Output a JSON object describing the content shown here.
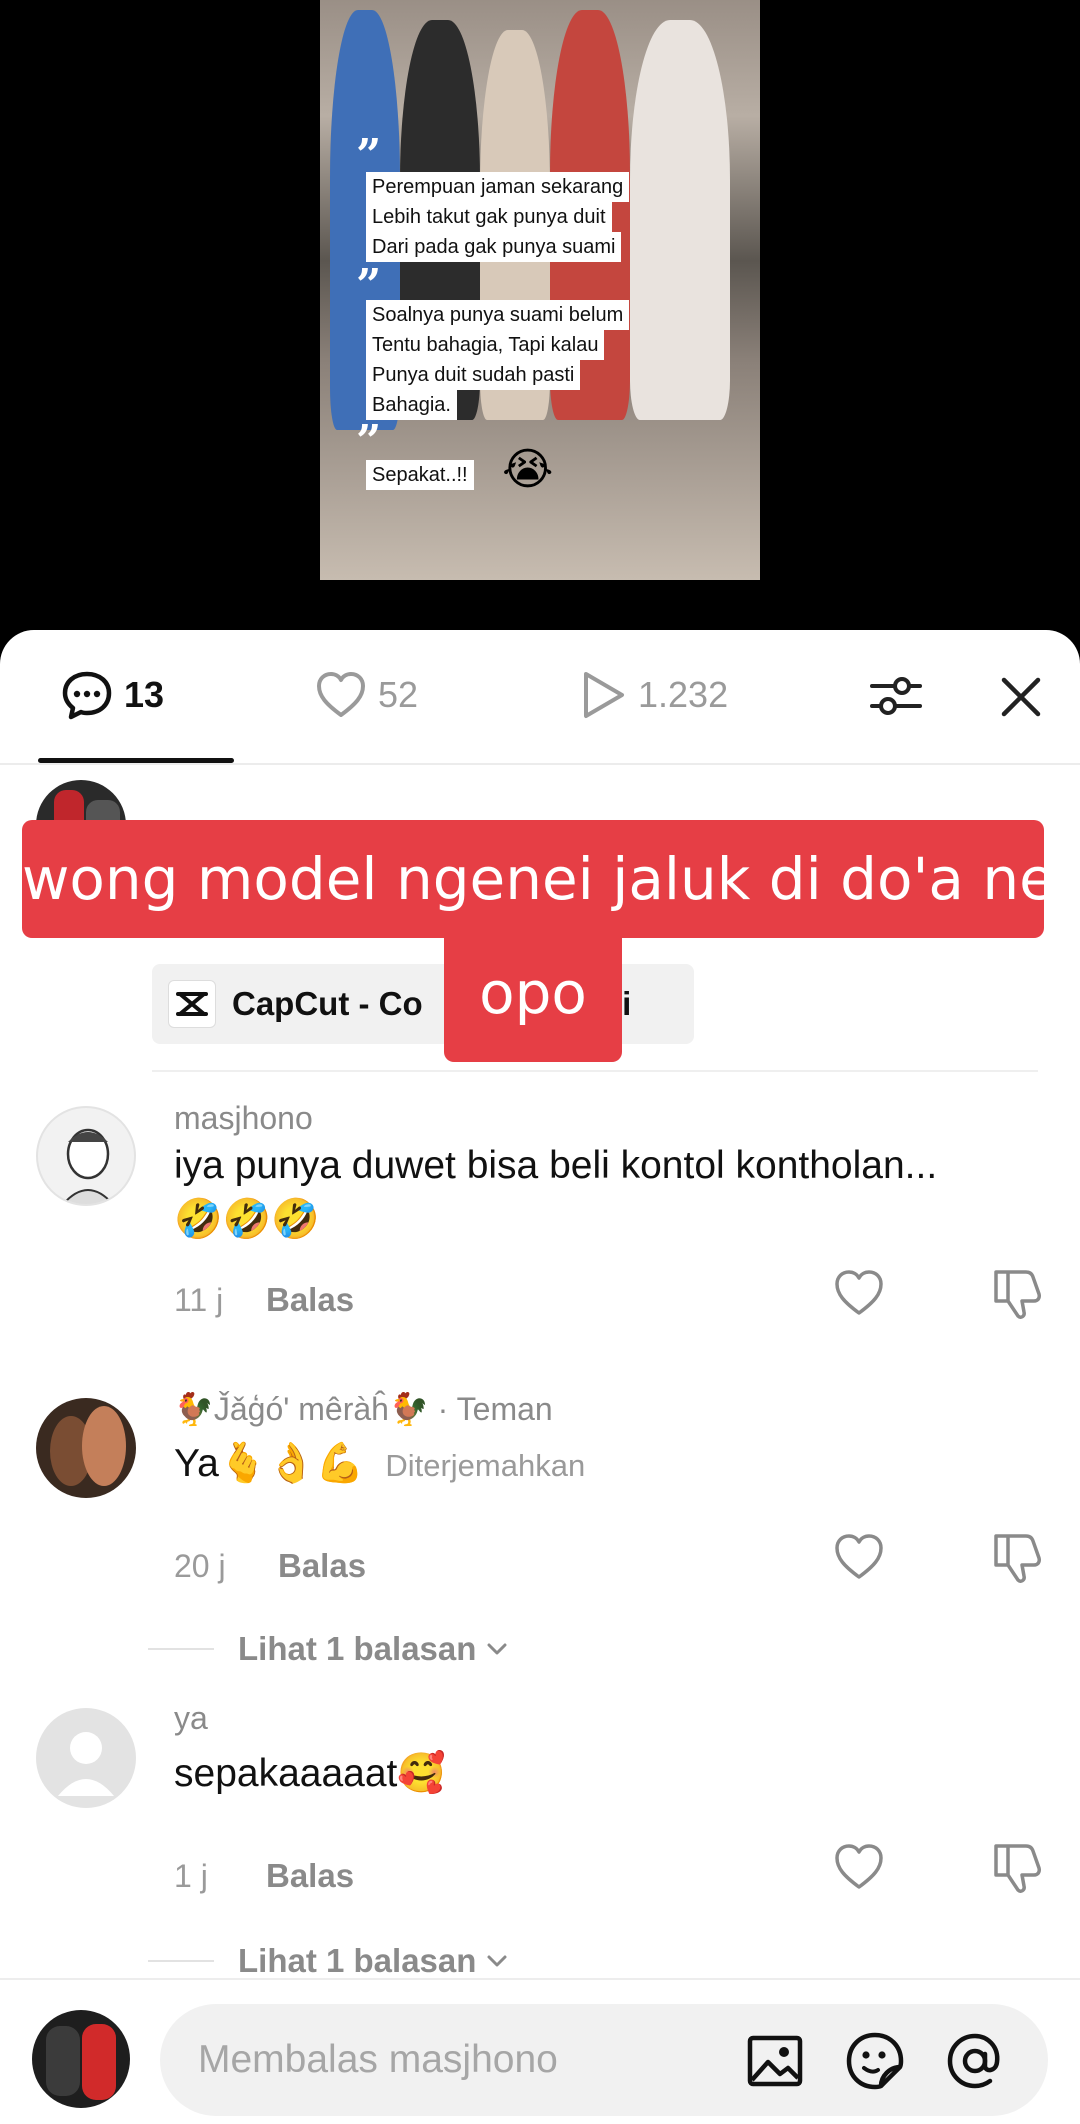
{
  "video": {
    "caption_lines": [
      "Perempuan jaman sekarang",
      "Lebih takut gak punya duit",
      "Dari pada gak punya suami",
      "Soalnya punya suami belum",
      "Tentu bahagia, Tapi kalau",
      "Punya duit sudah pasti",
      "Bahagia.",
      "Sepakat..!!"
    ],
    "sticker_emoji": "😭"
  },
  "stats": {
    "comments": "13",
    "likes": "52",
    "plays": "1.232"
  },
  "overlay": {
    "banner_line1": "wong model ngenei jaluk di do'a  ne",
    "banner_line2": "opo"
  },
  "comment0": {
    "capcut_label": "CapCut - Co",
    "capcut_suffix": "t ini"
  },
  "comments": [
    {
      "username": "masjhono",
      "text": "iya punya duwet bisa beli kontol kontholan...",
      "emojis": "🤣🤣🤣",
      "time": "11 j",
      "reply_label": "Balas"
    },
    {
      "username": "🐓J̌ǎģó' mêràĥ🐓",
      "friend_tag": " · Teman",
      "text": "Ya🫰👌💪",
      "translated": "Diterjemahkan",
      "time": "20 j",
      "reply_label": "Balas",
      "view_replies": "Lihat 1 balasan"
    },
    {
      "username": "ya",
      "text": "sepakaaaaat🥰",
      "time": "1 j",
      "reply_label": "Balas",
      "view_replies": "Lihat 1 balasan"
    }
  ],
  "bottom": {
    "input_placeholder": "Membalas masjhono"
  },
  "colors": {
    "overlay_red": "#e63e45",
    "muted_text": "#8a8a8a"
  },
  "icons": [
    "comment-icon",
    "heart-icon",
    "play-icon",
    "filter-icon",
    "close-icon",
    "capcut-icon",
    "like-icon",
    "dislike-icon",
    "chevron-down-icon",
    "image-icon",
    "sticker-icon",
    "mention-icon"
  ]
}
